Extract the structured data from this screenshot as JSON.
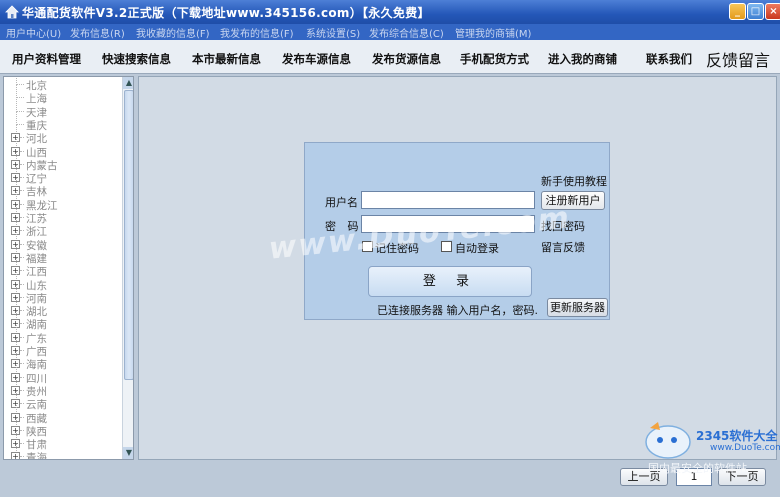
{
  "window": {
    "title": "华通配货软件V3.2正式版（下载地址www.345156.com）【永久免费】"
  },
  "menu": [
    "用户中心(U)",
    "发布信息(R)",
    "我收藏的信息(F)",
    "我发布的信息(F)",
    "系统设置(S)",
    "发布综合信息(C)",
    "管理我的商铺(M)"
  ],
  "toolbar": {
    "items": [
      "用户资料管理",
      "快速搜索信息",
      "本市最新信息",
      "发布车源信息",
      "发布货源信息",
      "手机配货方式",
      "进入我的商铺",
      "联系我们"
    ],
    "feedback": "反馈留言"
  },
  "regions": [
    "北京",
    "上海",
    "天津",
    "重庆",
    "河北",
    "山西",
    "内蒙古",
    "辽宁",
    "吉林",
    "黑龙江",
    "江苏",
    "浙江",
    "安徽",
    "福建",
    "江西",
    "山东",
    "河南",
    "湖北",
    "湖南",
    "广东",
    "广西",
    "海南",
    "四川",
    "贵州",
    "云南",
    "西藏",
    "陕西",
    "甘肃",
    "青海"
  ],
  "login": {
    "username_label": "用户名",
    "password_label": "密  码",
    "username_value": "",
    "password_value": "",
    "help_link": "新手使用教程",
    "register_button": "注册新用户",
    "forgot_link": "找回密码",
    "feedback_link": "留言反馈",
    "remember_label": "记住密码",
    "auto_login_label": "自动登录",
    "login_button": "登 录",
    "status_text": "已连接服务器  输入用户名，密码.",
    "update_server_button": "更新服务器"
  },
  "watermark": "www.DuoTe.com",
  "pager": {
    "prev": "上一页",
    "page": "1",
    "next": "下一页"
  },
  "corner_logo": {
    "brand": "2345软件大全",
    "url": "www.DuoTe.com",
    "slogan": "国内最安全的软件站"
  },
  "colors": {
    "titlebar": "#2457b8",
    "menubar": "#3366c4",
    "dialog": "#b4cde8",
    "background": "#bcc9d8"
  }
}
